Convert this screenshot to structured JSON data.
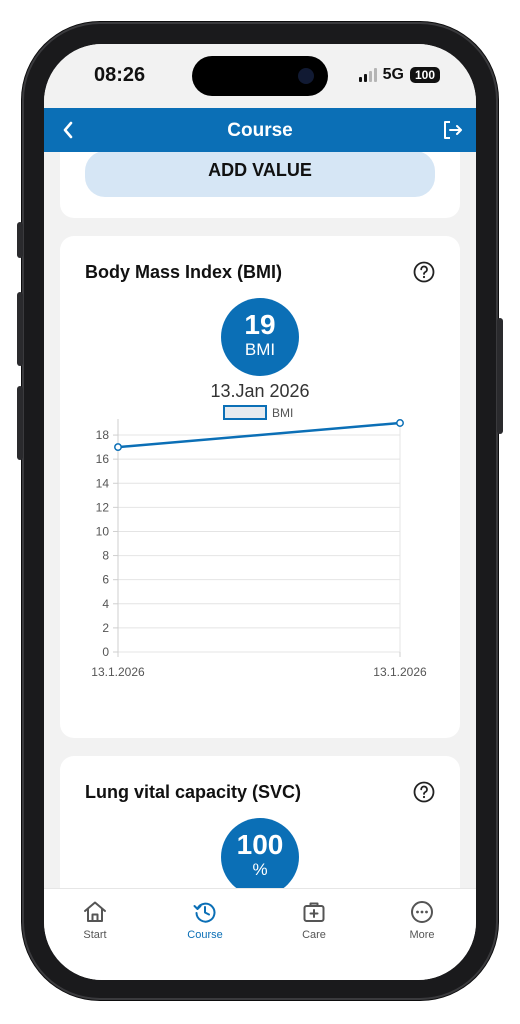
{
  "status_bar": {
    "time": "08:26",
    "network": "5G",
    "battery": "100"
  },
  "header": {
    "title": "Course"
  },
  "top_card": {
    "button_label": "ADD VALUE"
  },
  "bmi_card": {
    "title": "Body Mass Index (BMI)",
    "value": "19",
    "unit": "BMI",
    "date": "13.Jan 2026",
    "chart_data": {
      "type": "line",
      "legend": [
        "BMI"
      ],
      "x": [
        "13.1.2026",
        "13.1.2026"
      ],
      "series": [
        {
          "name": "BMI",
          "values": [
            17,
            19
          ]
        }
      ],
      "yticks": [
        "0",
        "2",
        "4",
        "6",
        "8",
        "10",
        "12",
        "14",
        "16",
        "18"
      ],
      "ylim": [
        0,
        19
      ],
      "grid": true,
      "legend_position": "top",
      "color": "#0b6fb6"
    }
  },
  "svc_card": {
    "title": "Lung vital capacity (SVC)",
    "value": "100",
    "unit": "%"
  },
  "nav": {
    "items": [
      {
        "label": "Start",
        "icon": "home-icon"
      },
      {
        "label": "Course",
        "icon": "history-icon"
      },
      {
        "label": "Care",
        "icon": "medical-kit-icon"
      },
      {
        "label": "More",
        "icon": "more-icon"
      }
    ],
    "active_color": "#0b6fb6"
  }
}
